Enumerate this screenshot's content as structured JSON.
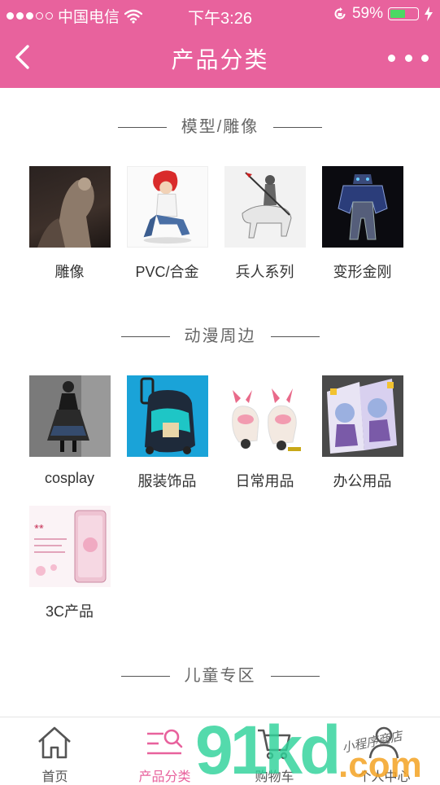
{
  "status_bar": {
    "carrier": "中国电信",
    "time": "下午3:26",
    "battery_percent": "59%",
    "battery_level": 0.59,
    "signal_bars_filled": 3,
    "signal_bars_total": 5
  },
  "nav": {
    "title": "产品分类"
  },
  "sections": [
    {
      "title": "模型/雕像",
      "items": [
        {
          "label": "雕像"
        },
        {
          "label": "PVC/合金"
        },
        {
          "label": "兵人系列"
        },
        {
          "label": "变形金刚"
        }
      ]
    },
    {
      "title": "动漫周边",
      "items": [
        {
          "label": "cosplay"
        },
        {
          "label": "服装饰品"
        },
        {
          "label": "日常用品"
        },
        {
          "label": "办公用品"
        },
        {
          "label": "3C产品"
        }
      ]
    },
    {
      "title": "儿童专区",
      "items": []
    }
  ],
  "tabbar": {
    "tabs": [
      {
        "label": "首页"
      },
      {
        "label": "产品分类"
      },
      {
        "label": "购物车"
      },
      {
        "label": "个人中心"
      }
    ],
    "active_index": 1
  },
  "colors": {
    "brand": "#e8629d",
    "watermark_green": "#2fd39a",
    "watermark_orange": "#f4a323"
  },
  "watermark": {
    "text": "91kd.com",
    "script": "小程序商店"
  }
}
